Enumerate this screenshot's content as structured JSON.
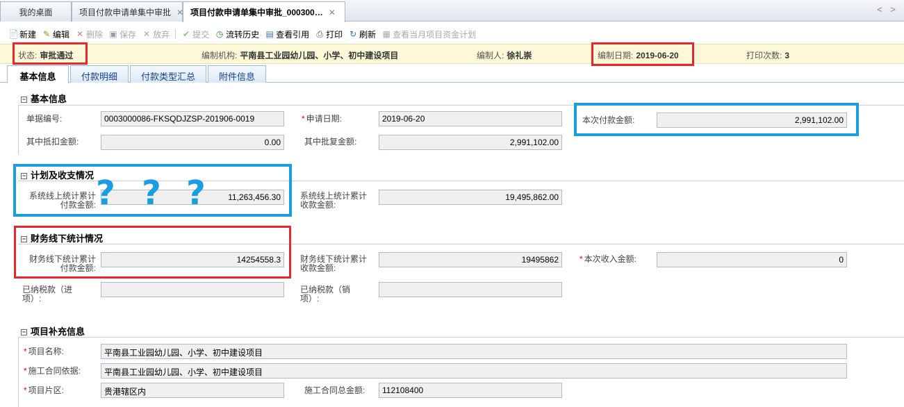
{
  "tabs": [
    {
      "label": "我的桌面"
    },
    {
      "label": "项目付款申请单集中审批",
      "close": "✕"
    },
    {
      "label": "项目付款申请单集中审批_000300…",
      "close": "✕"
    }
  ],
  "tab_nav": "< >",
  "toolbar": [
    {
      "label": "新建",
      "icon": "new-icon"
    },
    {
      "label": "编辑",
      "icon": "edit-icon"
    },
    {
      "label": "删除",
      "icon": "delete-icon"
    },
    {
      "label": "保存",
      "icon": "save-icon"
    },
    {
      "label": "放弃",
      "icon": "discard-icon"
    },
    {
      "label": "提交",
      "icon": "submit-icon"
    },
    {
      "label": "流转历史",
      "icon": "history-icon"
    },
    {
      "label": "查看引用",
      "icon": "reference-icon"
    },
    {
      "label": "打印",
      "icon": "print-icon"
    },
    {
      "label": "刷新",
      "icon": "refresh-icon"
    },
    {
      "label": "查看当月项目资金计划",
      "icon": "plan-icon"
    }
  ],
  "status": {
    "state_label": "状态:",
    "state_value": "审批通过",
    "org_label": "编制机构:",
    "org_value": "平南县工业园幼儿园、小学、初中建设项目",
    "author_label": "编制人:",
    "author_value": "徐礼崇",
    "date_label": "编制日期:",
    "date_value": "2019-06-20",
    "print_label": "打印次数:",
    "print_value": "3"
  },
  "subtabs": [
    {
      "label": "基本信息"
    },
    {
      "label": "付款明细"
    },
    {
      "label": "付款类型汇总"
    },
    {
      "label": "附件信息"
    }
  ],
  "basic": {
    "title": "基本信息",
    "doc_no_label": "单据编号:",
    "doc_no": "0003000086-FKSQDJZSP-201906-0019",
    "apply_date_label": "申请日期:",
    "apply_date": "2019-06-20",
    "pay_amount_label": "本次付款金额:",
    "pay_amount": "2,991,102.00",
    "deduct_label": "其中抵扣金额:",
    "deduct": "0.00",
    "approved_label": "其中批复金额:",
    "approved": "2,991,102.00"
  },
  "plan": {
    "title": "计划及收支情况",
    "online_pay_label": "系统线上统计累计付款金额:",
    "online_pay": "11,263,456.30",
    "online_recv_label": "系统线上统计累计收款金额:",
    "online_recv": "19,495,862.00",
    "question_marks": [
      "?",
      "?",
      "?"
    ]
  },
  "finance": {
    "title": "财务线下统计情况",
    "offline_pay_label": "财务线下统计累计付款金额:",
    "offline_pay": "14254558.3",
    "offline_recv_label": "财务线下统计累计收款金额:",
    "offline_recv": "19495862",
    "income_label": "本次收入金额:",
    "income": "0",
    "tax_in_label": "已纳税款（进项）:",
    "tax_in": "",
    "tax_out_label": "已纳税款（销项）:",
    "tax_out": ""
  },
  "project": {
    "title": "项目补充信息",
    "name_label": "项目名称:",
    "name": "平南县工业园幼儿园、小学、初中建设项目",
    "contract_label": "施工合同依据:",
    "contract": "平南县工业园幼儿园、小学、初中建设项目",
    "area_label": "项目片区:",
    "area": "贵港辖区内",
    "total_label": "施工合同总金额:",
    "total": "112108400"
  },
  "colors": {
    "red_box": "#e8262b",
    "blue_box": "#1a9ee0",
    "status_bg": "#fdf9d8"
  }
}
